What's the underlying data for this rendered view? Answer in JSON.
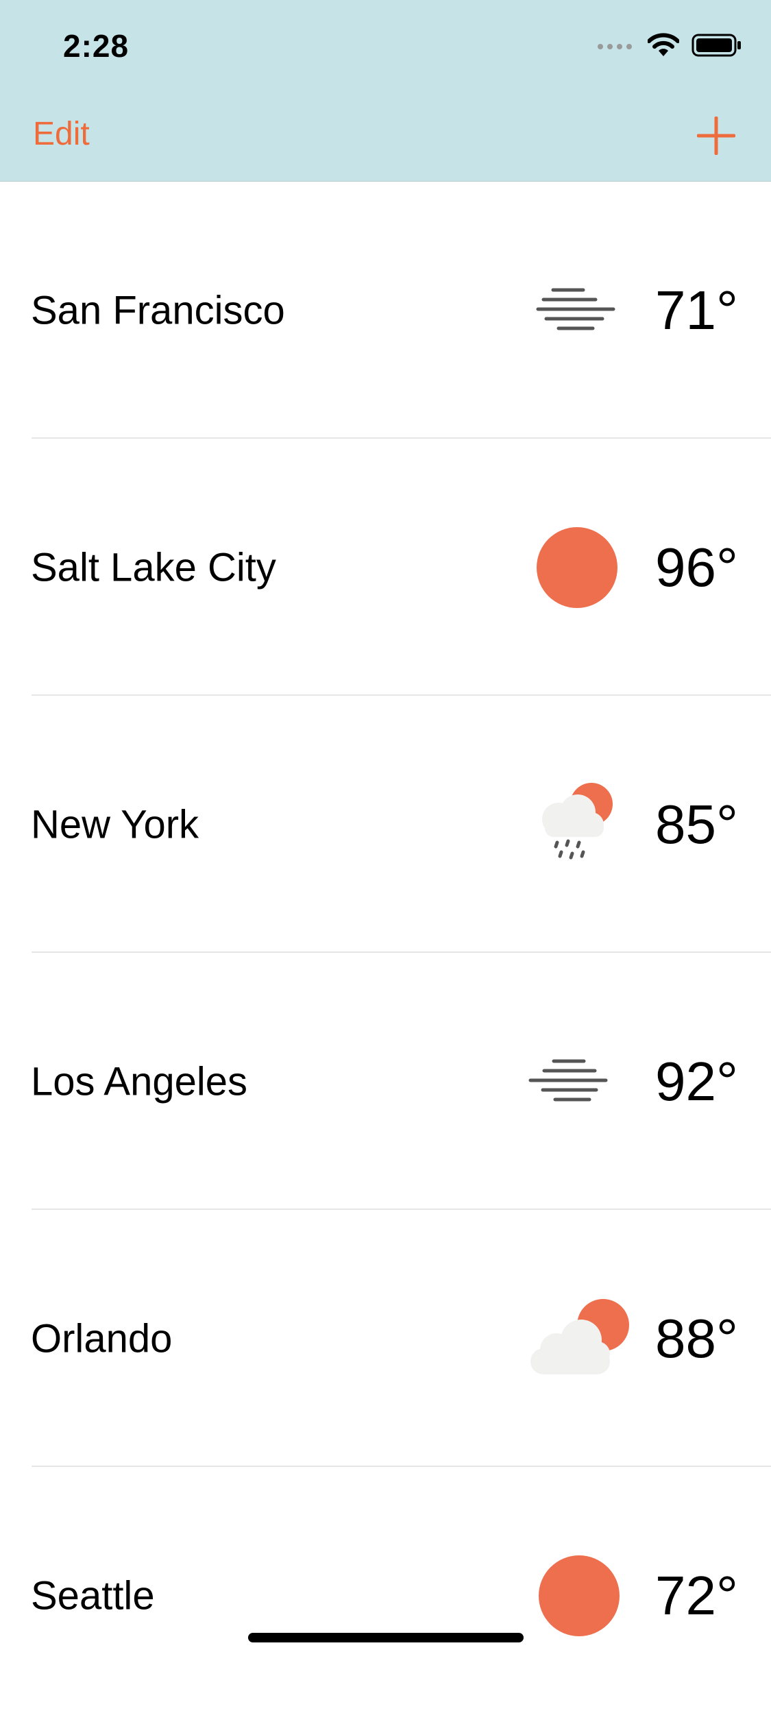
{
  "status_bar": {
    "time": "2:28"
  },
  "nav": {
    "edit_label": "Edit",
    "add_icon": "plus-icon"
  },
  "colors": {
    "accent": "#ee6b3b",
    "header_bg": "#c6e3e8",
    "icon_gray": "#555555",
    "cloud": "#f1f1f0"
  },
  "cities": [
    {
      "name": "San Francisco",
      "temp": "71°",
      "condition_icon": "fog-icon"
    },
    {
      "name": "Salt Lake City",
      "temp": "96°",
      "condition_icon": "sun-icon"
    },
    {
      "name": "New York",
      "temp": "85°",
      "condition_icon": "sun-cloud-rain-icon"
    },
    {
      "name": "Los Angeles",
      "temp": "92°",
      "condition_icon": "fog-icon"
    },
    {
      "name": "Orlando",
      "temp": "88°",
      "condition_icon": "partly-cloudy-icon"
    },
    {
      "name": "Seattle",
      "temp": "72°",
      "condition_icon": "sun-icon"
    }
  ]
}
